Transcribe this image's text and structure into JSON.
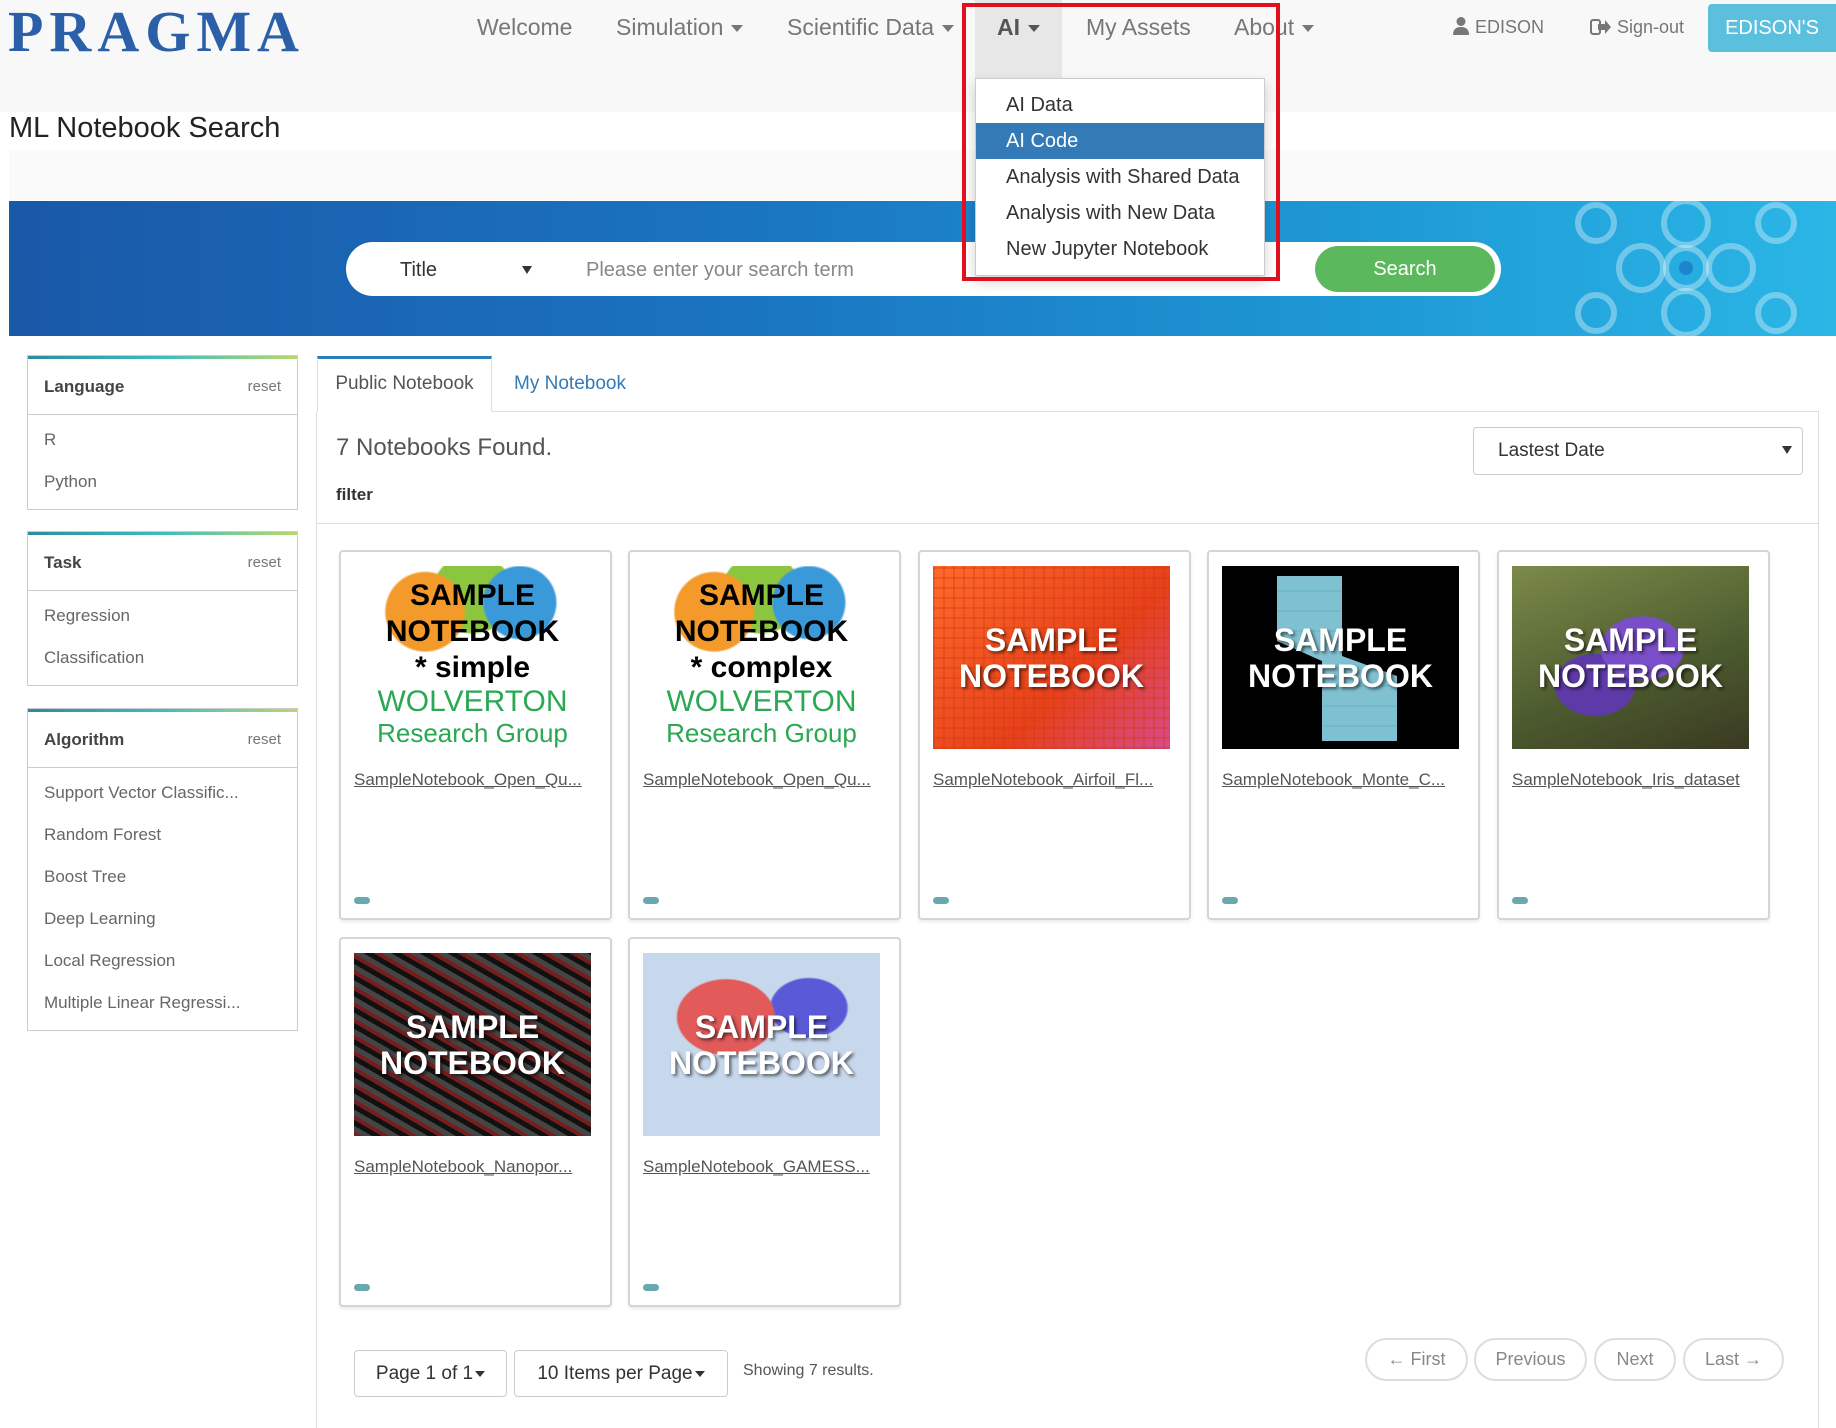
{
  "brand": {
    "logo_text": "PRAGMA"
  },
  "nav": {
    "welcome": "Welcome",
    "simulation": "Simulation",
    "scientific_data": "Scientific Data",
    "ai": "AI",
    "my_assets": "My Assets",
    "about": "About",
    "user": "EDISON",
    "signout": "Sign-out",
    "site_button": "EDISON'S"
  },
  "ai_menu": {
    "items": [
      "AI Data",
      "AI Code",
      "Analysis with Shared Data",
      "Analysis with New Data",
      "New Jupyter Notebook"
    ],
    "active_index": 1
  },
  "page": {
    "title": "ML Notebook Search"
  },
  "search": {
    "field": "Title",
    "placeholder": "Please enter your search term",
    "button": "Search"
  },
  "facets": {
    "reset_label": "reset",
    "language": {
      "title": "Language",
      "items": [
        "R",
        "Python"
      ]
    },
    "task": {
      "title": "Task",
      "items": [
        "Regression",
        "Classification"
      ]
    },
    "algorithm": {
      "title": "Algorithm",
      "items": [
        "Support Vector Classific...",
        "Random Forest",
        "Boost Tree",
        "Deep Learning",
        "Local Regression",
        "Multiple Linear Regressi..."
      ]
    }
  },
  "tabs": {
    "public": "Public Notebook",
    "mine": "My Notebook"
  },
  "results": {
    "found": "7 Notebooks Found.",
    "filter_label": "filter",
    "sort": "Lastest Date"
  },
  "cards": [
    {
      "thumb_line1": "SAMPLE",
      "thumb_line2": "NOTEBOOK",
      "thumb_line3": "* simple",
      "thumb_line4": "WOLVERTON",
      "thumb_line5": "Research Group",
      "title": "SampleNotebook_Open_Qu..."
    },
    {
      "thumb_line1": "SAMPLE",
      "thumb_line2": "NOTEBOOK",
      "thumb_line3": "* complex",
      "thumb_line4": "WOLVERTON",
      "thumb_line5": "Research Group",
      "title": "SampleNotebook_Open_Qu..."
    },
    {
      "thumb_line1": "SAMPLE",
      "thumb_line2": "NOTEBOOK",
      "title": "SampleNotebook_Airfoil_Fl..."
    },
    {
      "thumb_line1": "SAMPLE",
      "thumb_line2": "NOTEBOOK",
      "title": "SampleNotebook_Monte_C..."
    },
    {
      "thumb_line1": "SAMPLE",
      "thumb_line2": "NOTEBOOK",
      "title": "SampleNotebook_Iris_dataset"
    },
    {
      "thumb_line1": "SAMPLE",
      "thumb_line2": "NOTEBOOK",
      "title": "SampleNotebook_Nanopor..."
    },
    {
      "thumb_line1": "SAMPLE",
      "thumb_line2": "NOTEBOOK",
      "title": "SampleNotebook_GAMESS..."
    }
  ],
  "pagination": {
    "page": "Page 1 of 1",
    "per_page": "10 Items per Page",
    "showing": "Showing 7 results.",
    "first": "← First",
    "previous": "Previous",
    "next": "Next",
    "last": "Last →"
  },
  "colors": {
    "accent": "#337ab7",
    "search_button": "#5cb85c",
    "site_button": "#5bc0de",
    "highlight": "#e0101e"
  },
  "icons": {
    "user": "user-icon",
    "signout": "sign-out-icon"
  }
}
